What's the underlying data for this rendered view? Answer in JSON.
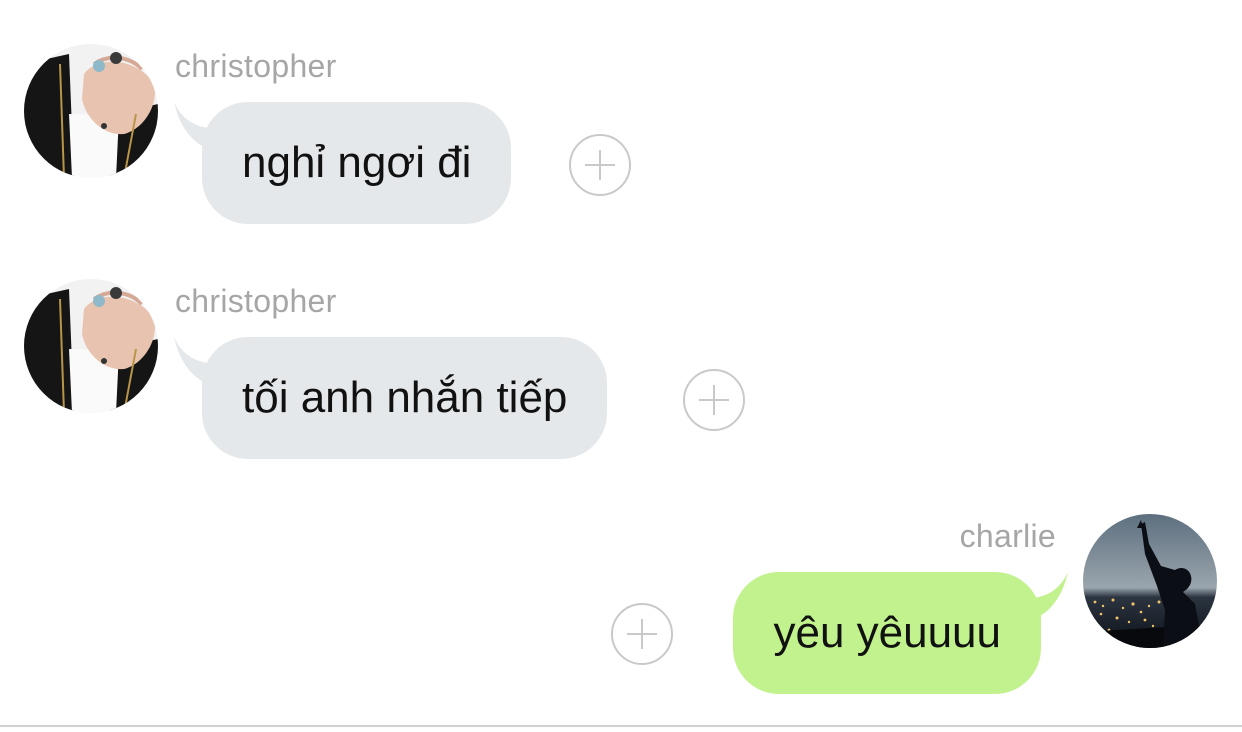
{
  "messages": [
    {
      "sender": "christopher",
      "direction": "incoming",
      "text": "nghỉ ngơi đi",
      "avatar_icon": "person-with-rings-avatar"
    },
    {
      "sender": "christopher",
      "direction": "incoming",
      "text": "tối anh nhắn tiếp",
      "avatar_icon": "person-with-rings-avatar"
    },
    {
      "sender": "charlie",
      "direction": "outgoing",
      "text": "yêu yêuuuu",
      "avatar_icon": "city-night-silhouette-avatar"
    }
  ],
  "colors": {
    "incoming_bubble": "#e5e8eb",
    "outgoing_bubble": "#c2f28d",
    "sender_name": "#a6a6a6",
    "add_button": "#c9c9c9"
  },
  "icons": {
    "add_reaction": "plus-circle-icon"
  }
}
